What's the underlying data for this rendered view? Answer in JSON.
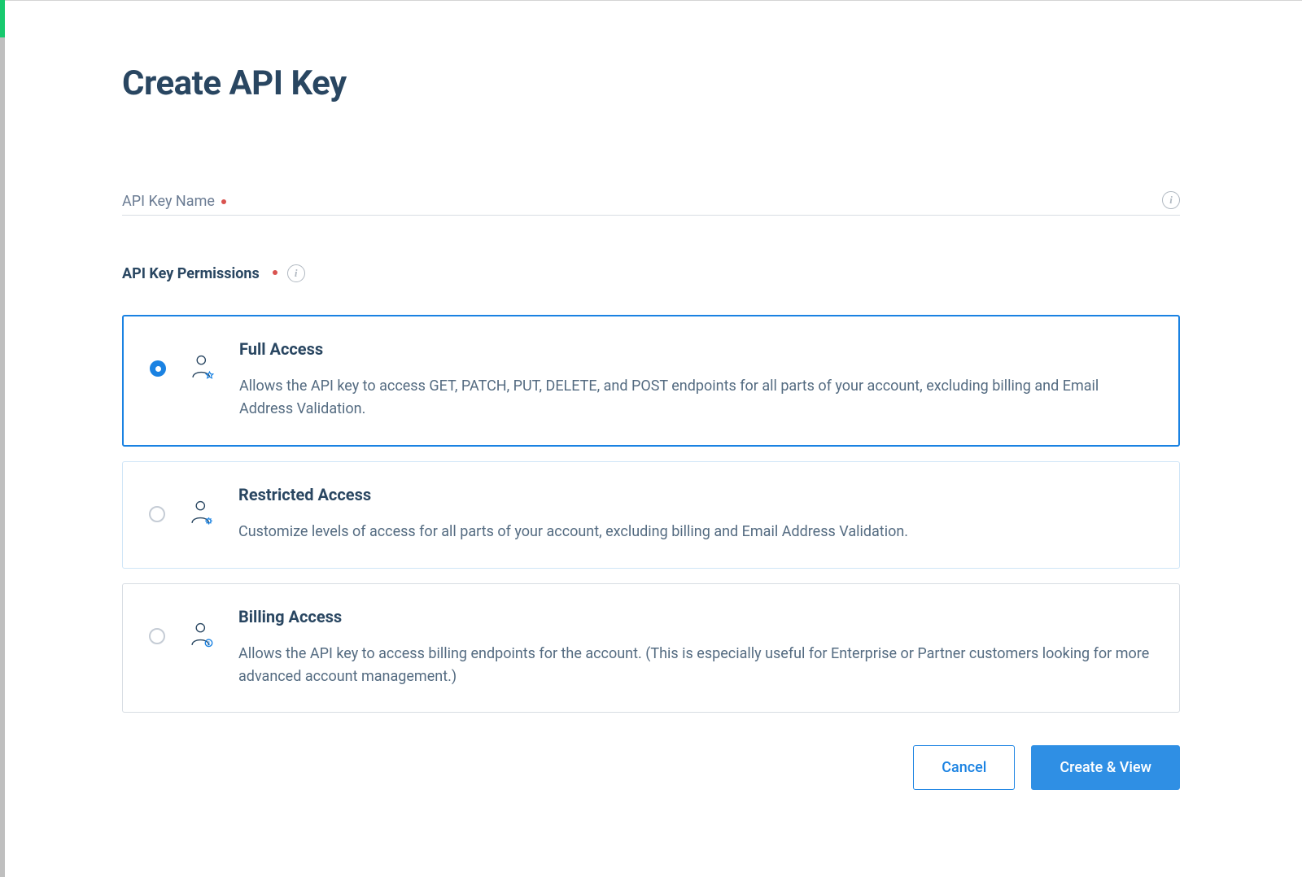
{
  "page": {
    "title": "Create API Key"
  },
  "fields": {
    "name_label": "API Key Name"
  },
  "permissions": {
    "label": "API Key Permissions",
    "options": [
      {
        "title": "Full Access",
        "description": "Allows the API key to access GET, PATCH, PUT, DELETE, and POST endpoints for all parts of your account, excluding billing and Email Address Validation.",
        "selected": true
      },
      {
        "title": "Restricted Access",
        "description": "Customize levels of access for all parts of your account, excluding billing and Email Address Validation.",
        "selected": false
      },
      {
        "title": "Billing Access",
        "description": "Allows the API key to access billing endpoints for the account. (This is especially useful for Enterprise or Partner customers looking for more advanced account management.)",
        "selected": false
      }
    ]
  },
  "buttons": {
    "cancel": "Cancel",
    "submit": "Create & View"
  }
}
